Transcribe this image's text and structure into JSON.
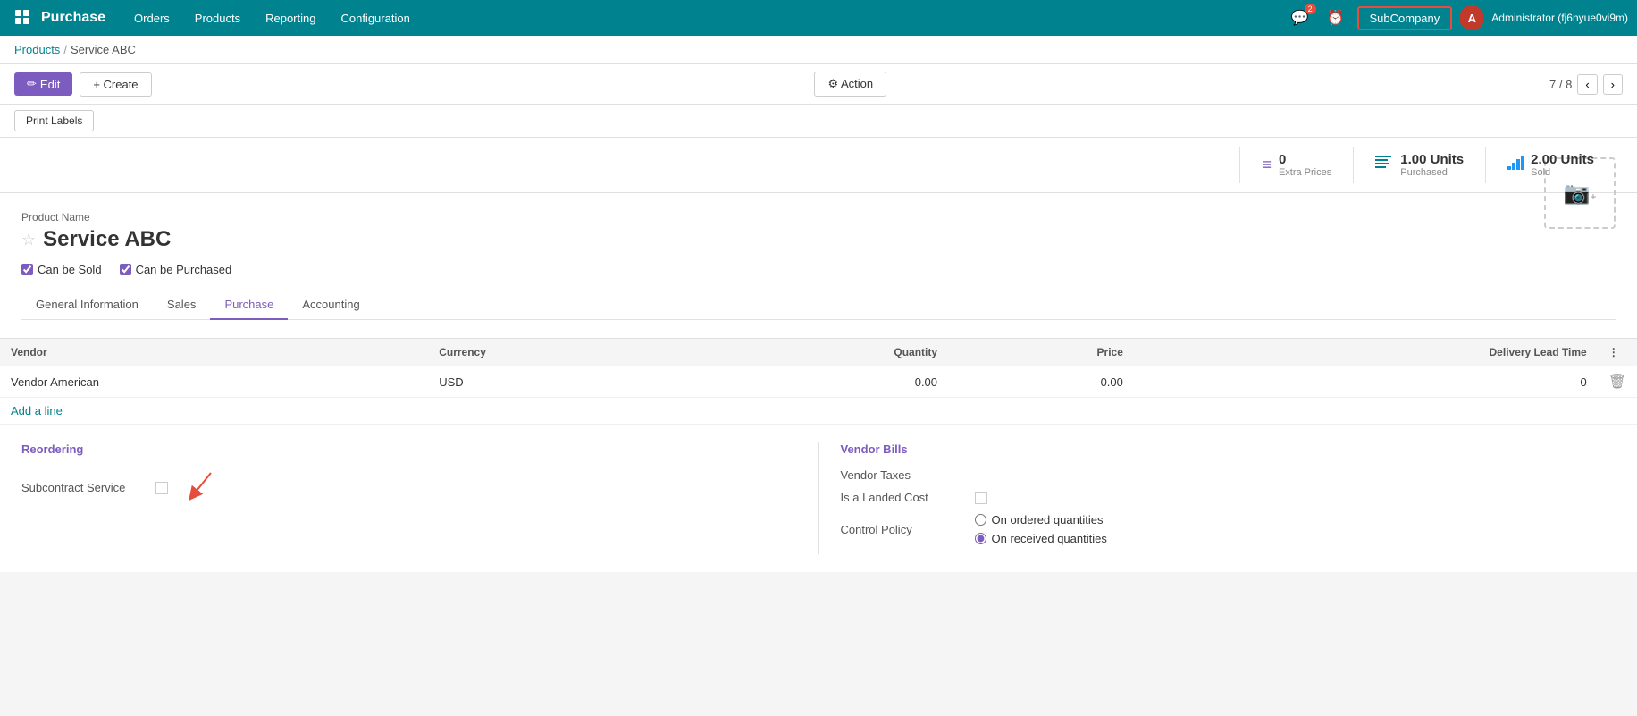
{
  "app": {
    "title": "Purchase"
  },
  "nav": {
    "items": [
      "Orders",
      "Products",
      "Reporting",
      "Configuration"
    ],
    "icons": {
      "grid": "⊞",
      "chat": "💬",
      "chat_badge": "2",
      "clock": "⏰",
      "bell": "🔔"
    },
    "subcompany_label": "SubCompany",
    "user_initial": "A",
    "user_name": "Administrator (fj6nyue0vi9m)"
  },
  "breadcrumb": {
    "parent": "Products",
    "separator": "/",
    "current": "Service ABC"
  },
  "toolbar": {
    "edit_label": "Edit",
    "create_label": "+ Create",
    "action_label": "⚙ Action",
    "pagination": "7 / 8"
  },
  "secondary_toolbar": {
    "print_labels": "Print Labels"
  },
  "stats": [
    {
      "icon": "≡",
      "icon_color": "purple",
      "number": "0",
      "label": "Extra Prices"
    },
    {
      "icon": "💳",
      "icon_color": "teal",
      "number": "1.00 Units",
      "label": "Purchased"
    },
    {
      "icon": "📊",
      "icon_color": "blue",
      "number": "2.00 Units",
      "label": "Sold"
    }
  ],
  "product": {
    "name_label": "Product Name",
    "title": "Service ABC",
    "can_be_sold": true,
    "can_be_sold_label": "Can be Sold",
    "can_be_purchased": true,
    "can_be_purchased_label": "Can be Purchased"
  },
  "tabs": [
    {
      "id": "general",
      "label": "General Information"
    },
    {
      "id": "sales",
      "label": "Sales"
    },
    {
      "id": "purchase",
      "label": "Purchase",
      "active": true
    },
    {
      "id": "accounting",
      "label": "Accounting"
    }
  ],
  "vendor_table": {
    "headers": [
      "Vendor",
      "Currency",
      "Quantity",
      "Price",
      "Delivery Lead Time",
      ""
    ],
    "rows": [
      {
        "vendor": "Vendor American",
        "currency": "USD",
        "quantity": "0.00",
        "price": "0.00",
        "delivery_lead_time": "0"
      }
    ],
    "add_line": "Add a line"
  },
  "reordering": {
    "section_title": "Reordering",
    "fields": [
      {
        "label": "Subcontract Service",
        "type": "checkbox",
        "value": false
      }
    ]
  },
  "vendor_bills": {
    "section_title": "Vendor Bills",
    "fields": [
      {
        "label": "Vendor Taxes",
        "type": "text",
        "value": ""
      },
      {
        "label": "Is a Landed Cost",
        "type": "checkbox",
        "value": false
      },
      {
        "label": "Control Policy",
        "type": "radio",
        "options": [
          {
            "label": "On ordered quantities",
            "checked": false
          },
          {
            "label": "On received quantities",
            "checked": true
          }
        ]
      }
    ]
  }
}
